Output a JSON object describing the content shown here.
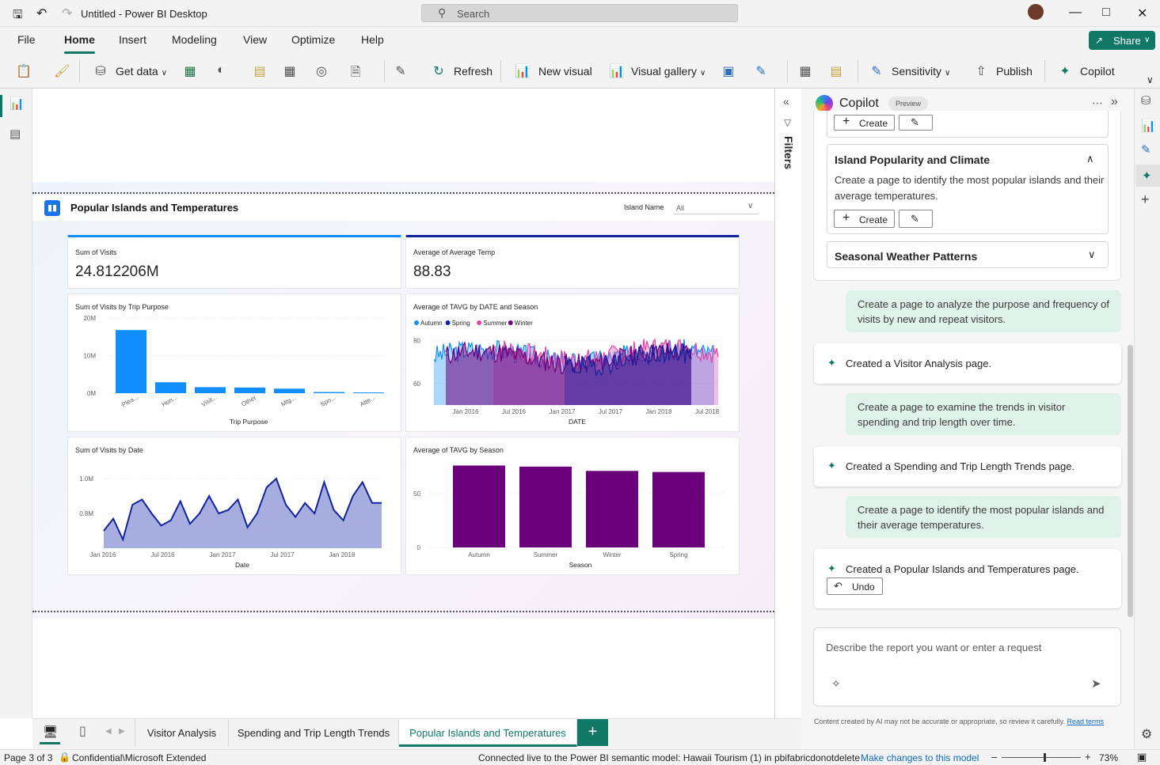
{
  "window": {
    "title": "Untitled - Power BI Desktop",
    "search_label": "Search"
  },
  "menu": {
    "items": [
      "File",
      "Home",
      "Insert",
      "Modeling",
      "View",
      "Optimize",
      "Help"
    ],
    "share": "Share"
  },
  "ribbon": {
    "get_data": "Get data",
    "refresh": "Refresh",
    "new_visual": "New visual",
    "visual_gallery": "Visual gallery",
    "sensitivity": "Sensitivity",
    "publish": "Publish",
    "copilot": "Copilot"
  },
  "report": {
    "title": "Popular Islands and Temperatures",
    "slicer_label": "Island Name",
    "slicer_value": "All",
    "kpi1": {
      "title": "Sum of Visits",
      "value": "24.812206M"
    },
    "kpi2": {
      "title": "Average of Average Temp",
      "value": "88.83"
    }
  },
  "chart_data": [
    {
      "type": "bar",
      "title": "Sum of Visits by Trip Purpose",
      "xlabel": "Trip Purpose",
      "ylabel": "",
      "yticks": [
        "20M",
        "10M",
        "0M"
      ],
      "categories": [
        "Plea...",
        "Hon...",
        "Visit...",
        "Other",
        "Mtg...",
        "Spo...",
        "Atte..."
      ],
      "values": [
        16.8,
        2.9,
        1.6,
        1.5,
        1.2,
        0.3,
        0.2
      ],
      "ylim": [
        0,
        20
      ]
    },
    {
      "type": "area",
      "title": "Average of TAVG by DATE and Season",
      "xlabel": "DATE",
      "ylabel": "",
      "legend": [
        "Autumn",
        "Spring",
        "Summer",
        "Winter"
      ],
      "legend_position": "top-left",
      "colors": [
        "#118dff",
        "#12239e",
        "#e044a7",
        "#6b007b"
      ],
      "yticks": [
        "80",
        "60"
      ],
      "xticks": [
        "Jan 2016",
        "Jul 2016",
        "Jan 2017",
        "Jul 2017",
        "Jan 2018",
        "Jul 2018"
      ],
      "ylim": [
        50,
        85
      ]
    },
    {
      "type": "area",
      "title": "Sum of Visits by Date",
      "xlabel": "Date",
      "ylabel": "",
      "yticks": [
        "1.0M",
        "0.8M"
      ],
      "xticks": [
        "Jan 2016",
        "Jul 2016",
        "Jan 2017",
        "Jul 2017",
        "Jan 2018"
      ],
      "values": [
        0.7,
        0.77,
        0.65,
        0.85,
        0.88,
        0.8,
        0.73,
        0.76,
        0.87,
        0.74,
        0.8,
        0.9,
        0.8,
        0.82,
        0.88,
        0.72,
        0.8,
        0.95,
        1.0,
        0.85,
        0.78,
        0.86,
        0.8,
        0.98,
        0.82,
        0.76,
        0.9,
        0.98,
        0.86,
        0.86
      ],
      "ylim": [
        0.6,
        1.1
      ]
    },
    {
      "type": "bar",
      "title": "Average of TAVG by Season",
      "xlabel": "Season",
      "ylabel": "",
      "yticks": [
        "50",
        "0"
      ],
      "categories": [
        "Autumn",
        "Summer",
        "Winter",
        "Spring"
      ],
      "values": [
        76,
        75,
        71,
        70
      ],
      "ylim": [
        0,
        80
      ]
    }
  ],
  "copilot": {
    "title": "Copilot",
    "badge": "Preview",
    "create": "Create",
    "suggestion1": {
      "title": "Island Popularity and Climate",
      "body": "Create a page to identify the most popular islands and their average temperatures."
    },
    "suggestion2": {
      "title": "Seasonal Weather Patterns"
    },
    "messages": [
      {
        "user": "Create a page to analyze the purpose and frequency of visits by new and repeat visitors.",
        "reply": "Created a Visitor Analysis page."
      },
      {
        "user": "Create a page to examine the trends in visitor spending and trip length over time.",
        "reply": "Created a Spending and Trip Length Trends page."
      },
      {
        "user": "Create a page to identify the most popular islands and their average temperatures.",
        "reply": "Created a Popular Islands and Temperatures page."
      }
    ],
    "undo": "Undo",
    "input_placeholder": "Describe the report you want or enter a request",
    "disclaimer": "Content created by AI may not be accurate or appropriate, so review it carefully.",
    "disclaimer_link": "Read terms"
  },
  "filters_label": "Filters",
  "pages": [
    "Visitor Analysis",
    "Spending and Trip Length Trends",
    "Popular Islands and Temperatures"
  ],
  "status": {
    "page": "Page 3 of 3",
    "sensitivity": "Confidential\\Microsoft Extended",
    "connection": "Connected live to the Power BI semantic model: Hawaii Tourism (1) in pbifabricdonotdelete",
    "make_changes": "Make changes to this model",
    "zoom": "73%",
    "zoom_level": 73
  }
}
